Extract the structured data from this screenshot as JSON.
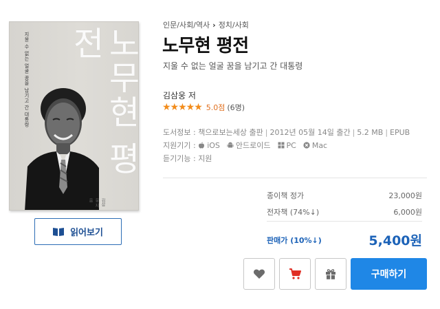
{
  "cover": {
    "title": "노무현 평전",
    "tagline": "지울 수 없는 얼굴 꿈을 남기고 간 대통령",
    "author": "김삼웅 지음"
  },
  "preview": {
    "label": "읽어보기",
    "icon": "book-open-icon"
  },
  "breadcrumb": {
    "category": "인문/사회/역사",
    "subcategory": "정치/사회"
  },
  "book": {
    "title": "노무현 평전",
    "subtitle": "지울 수 없는 얼굴 꿈을 남기고 간 대통령",
    "author": "김삼웅 저"
  },
  "rating": {
    "stars": "★★★★★",
    "score": "5.0점",
    "count": "(6명)",
    "value": 5.0,
    "max": 5,
    "color": "#f28c1b"
  },
  "info": {
    "bookinfo_label": "도서정보 :",
    "publisher": "책으로보는세상 출판",
    "date": "2012년 05월 14일 출간",
    "size": "5.2 MB",
    "format": "EPUB",
    "devices_label": "지원기기 :",
    "devices": [
      {
        "icon": "apple-icon",
        "name": "iOS"
      },
      {
        "icon": "android-icon",
        "name": "안드로이드"
      },
      {
        "icon": "windows-icon",
        "name": "PC"
      },
      {
        "icon": "mac-x-icon",
        "name": "Mac"
      }
    ],
    "listen_label": "듣기기능 :",
    "listen_value": "지원"
  },
  "pricing": {
    "paper_label": "종이책 정가",
    "paper_price": "23,000원",
    "ebook_label": "전자책 (74%↓)",
    "ebook_price": "6,000원",
    "sale_label": "판매가 (10%↓)",
    "sale_price": "5,400원"
  },
  "actions": {
    "wishlist_icon": "heart-icon",
    "cart_icon": "cart-icon",
    "gift_icon": "gift-icon",
    "buy_label": "구매하기",
    "buy_color": "#1f87e6",
    "cart_color": "#e02e24"
  }
}
